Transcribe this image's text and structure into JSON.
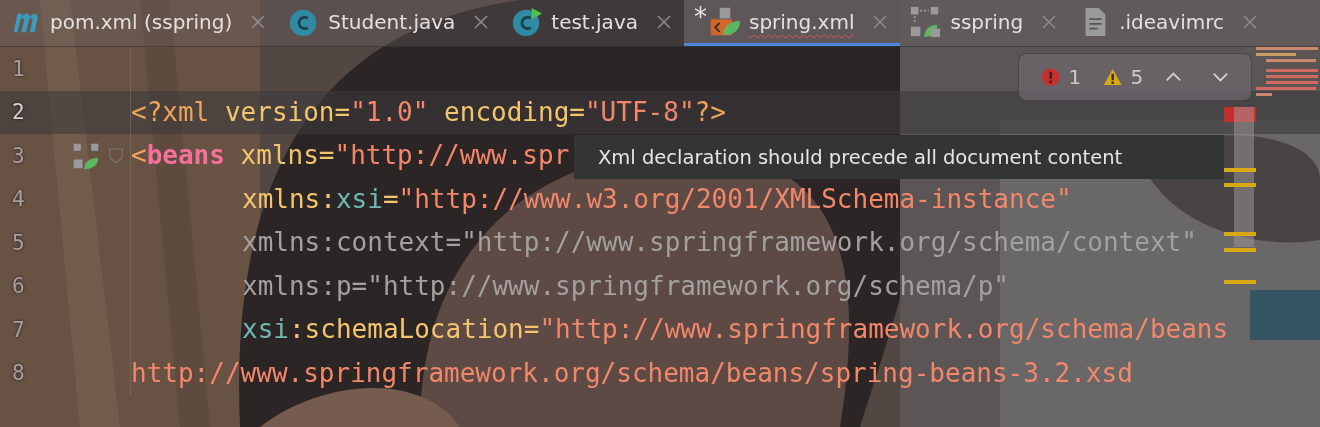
{
  "tabs": [
    {
      "kind": "maven",
      "label": "pom.xml (sspring)",
      "selected": false,
      "error": false
    },
    {
      "kind": "class",
      "label": "Student.java",
      "selected": false,
      "error": false
    },
    {
      "kind": "class-run",
      "label": "test.java",
      "selected": false,
      "error": false
    },
    {
      "kind": "spring-xml",
      "modified_mark": "*",
      "label": "spring.xml",
      "selected": true,
      "error": true
    },
    {
      "kind": "module",
      "label": "sspring",
      "selected": false,
      "error": false
    },
    {
      "kind": "text-file",
      "label": ".ideavimrc",
      "selected": false,
      "error": false
    }
  ],
  "inspections": {
    "errors": "1",
    "warnings": "5"
  },
  "lines": [
    {
      "number": "1",
      "current": false,
      "gutter_icon": false,
      "fold": false
    },
    {
      "number": "2",
      "current": true,
      "indented": false,
      "gutter_icon": false,
      "fold": false,
      "tokens": [
        {
          "kind": "tag",
          "text": "<?xml "
        },
        {
          "kind": "attr",
          "text": "version="
        },
        {
          "kind": "value",
          "text": "\"1.0\" "
        },
        {
          "kind": "attr",
          "text": "encoding="
        },
        {
          "kind": "value",
          "text": "\"UTF-8\""
        },
        {
          "kind": "tag",
          "text": "?>"
        }
      ]
    },
    {
      "number": "3",
      "current": false,
      "indented": false,
      "gutter_icon": true,
      "fold": true,
      "tokens": [
        {
          "kind": "tag",
          "text": "<"
        },
        {
          "kind": "element",
          "text": "beans "
        },
        {
          "kind": "attr",
          "text": "xmlns="
        },
        {
          "kind": "value",
          "text": "\"http://www.spr"
        }
      ]
    },
    {
      "number": "4",
      "current": false,
      "indented": true,
      "gutter_icon": false,
      "fold": false,
      "tokens": [
        {
          "kind": "attr",
          "text": "xmlns:"
        },
        {
          "kind": "ns",
          "text": "xsi"
        },
        {
          "kind": "attr",
          "text": "="
        },
        {
          "kind": "value",
          "text": "\"http://www.w3.org/2001/XMLSchema-instance\""
        }
      ]
    },
    {
      "number": "5",
      "current": false,
      "indented": true,
      "gutter_icon": false,
      "fold": false,
      "tokens": [
        {
          "kind": "unused",
          "text": "xmlns:context=\"http://www.springframework.org/schema/context\""
        }
      ]
    },
    {
      "number": "6",
      "current": false,
      "indented": true,
      "gutter_icon": false,
      "fold": false,
      "tokens": [
        {
          "kind": "unused",
          "text": "xmlns:p=\"http://www.springframework.org/schema/p\""
        }
      ]
    },
    {
      "number": "7",
      "current": false,
      "indented": true,
      "gutter_icon": false,
      "fold": false,
      "tokens": [
        {
          "kind": "ns",
          "text": "xsi"
        },
        {
          "kind": "attr",
          "text": ":schemaLocation="
        },
        {
          "kind": "value",
          "text": "\"http://www.springframework.org/schema/beans"
        }
      ]
    },
    {
      "number": "8",
      "current": false,
      "indented": false,
      "gutter_icon": false,
      "fold": false,
      "tokens": [
        {
          "kind": "value",
          "text": "http://www.springframework.org/schema/beans/spring-beans-3.2.xsd"
        }
      ]
    }
  ],
  "tooltip": "Xml declaration should precede all document content"
}
